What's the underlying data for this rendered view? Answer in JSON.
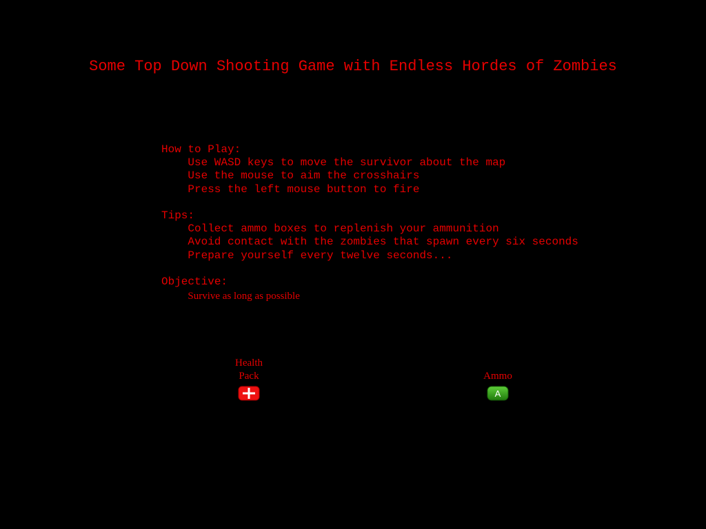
{
  "title": "Some Top Down Shooting Game with Endless Hordes of Zombies",
  "instructions": {
    "how_to_play": {
      "heading": "How to Play:",
      "lines": [
        "Use WASD keys to move the survivor about the map",
        "Use the mouse to aim the crosshairs",
        "Press the left mouse button to fire"
      ]
    },
    "tips": {
      "heading": "Tips:",
      "lines": [
        "Collect ammo boxes to replenish your ammunition",
        "Avoid contact with the zombies that spawn every six seconds",
        "Prepare yourself every twelve seconds..."
      ]
    },
    "objective": {
      "heading": "Objective:",
      "lines": [
        "Survive as long as possible"
      ]
    }
  },
  "legend": {
    "health_pack": {
      "label_line1": "Health",
      "label_line2": "Pack",
      "icon": "health-cross-icon",
      "color": "#ee1111"
    },
    "ammo": {
      "label": "Ammo",
      "icon": "ammo-box-icon",
      "icon_text": "A",
      "color": "#2e9e14"
    }
  },
  "colors": {
    "background": "#000000",
    "text": "#e60000"
  }
}
